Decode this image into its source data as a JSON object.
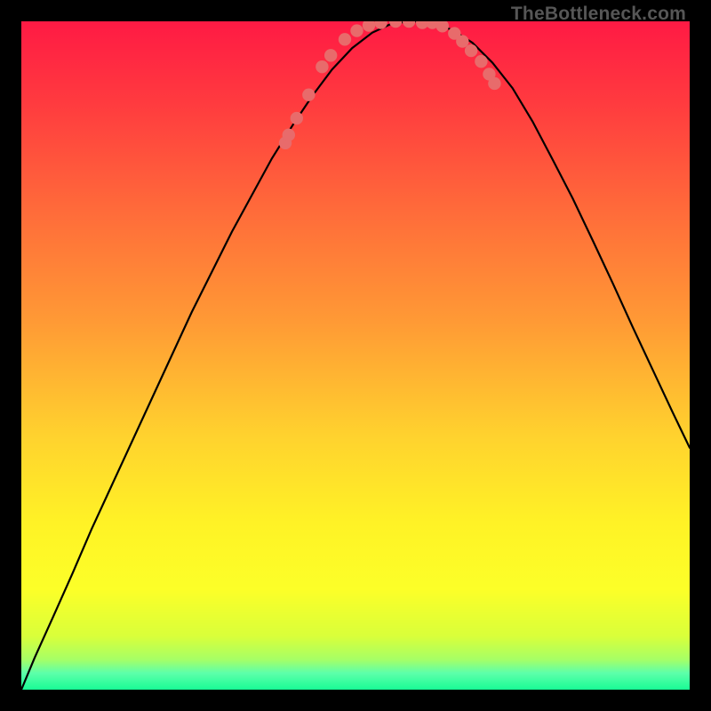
{
  "watermark": "TheBottleneck.com",
  "gradient": {
    "stops": [
      {
        "offset": 0.0,
        "color": "#ff1a44"
      },
      {
        "offset": 0.12,
        "color": "#ff3a3f"
      },
      {
        "offset": 0.28,
        "color": "#ff6a3a"
      },
      {
        "offset": 0.45,
        "color": "#ff9a35"
      },
      {
        "offset": 0.62,
        "color": "#ffd22e"
      },
      {
        "offset": 0.75,
        "color": "#fff226"
      },
      {
        "offset": 0.85,
        "color": "#fcff28"
      },
      {
        "offset": 0.92,
        "color": "#d9ff3a"
      },
      {
        "offset": 0.955,
        "color": "#a6ff66"
      },
      {
        "offset": 0.975,
        "color": "#5dffaa"
      },
      {
        "offset": 1.0,
        "color": "#19fc95"
      }
    ]
  },
  "chart_data": {
    "type": "line",
    "title": "",
    "xlabel": "",
    "ylabel": "",
    "xlim": [
      0,
      100
    ],
    "ylim": [
      0,
      100
    ],
    "series": [
      {
        "name": "curve",
        "x_norm": [
          0.0,
          0.02,
          0.048,
          0.077,
          0.105,
          0.135,
          0.165,
          0.195,
          0.225,
          0.255,
          0.285,
          0.315,
          0.345,
          0.375,
          0.405,
          0.435,
          0.465,
          0.495,
          0.525,
          0.555,
          0.585,
          0.615,
          0.645,
          0.675,
          0.705,
          0.735,
          0.765,
          0.795,
          0.825,
          0.855,
          0.885,
          0.915,
          0.945,
          0.975,
          1.0
        ],
        "y_norm": [
          0.0,
          0.048,
          0.11,
          0.175,
          0.24,
          0.305,
          0.37,
          0.435,
          0.5,
          0.565,
          0.625,
          0.685,
          0.74,
          0.795,
          0.843,
          0.888,
          0.928,
          0.96,
          0.983,
          0.997,
          1.0,
          0.998,
          0.987,
          0.968,
          0.938,
          0.9,
          0.85,
          0.793,
          0.735,
          0.672,
          0.608,
          0.542,
          0.478,
          0.414,
          0.362
        ]
      }
    ],
    "markers": {
      "name": "highlight-points",
      "color": "#e86b6b",
      "x_norm": [
        0.395,
        0.4,
        0.412,
        0.43,
        0.45,
        0.463,
        0.484,
        0.502,
        0.52,
        0.538,
        0.56,
        0.58,
        0.6,
        0.615,
        0.63,
        0.648,
        0.66,
        0.673,
        0.688,
        0.7,
        0.708
      ],
      "y_norm": [
        0.818,
        0.83,
        0.855,
        0.89,
        0.932,
        0.949,
        0.973,
        0.986,
        0.994,
        0.998,
        1.0,
        1.0,
        0.998,
        0.998,
        0.993,
        0.982,
        0.97,
        0.956,
        0.94,
        0.921,
        0.907
      ]
    }
  }
}
